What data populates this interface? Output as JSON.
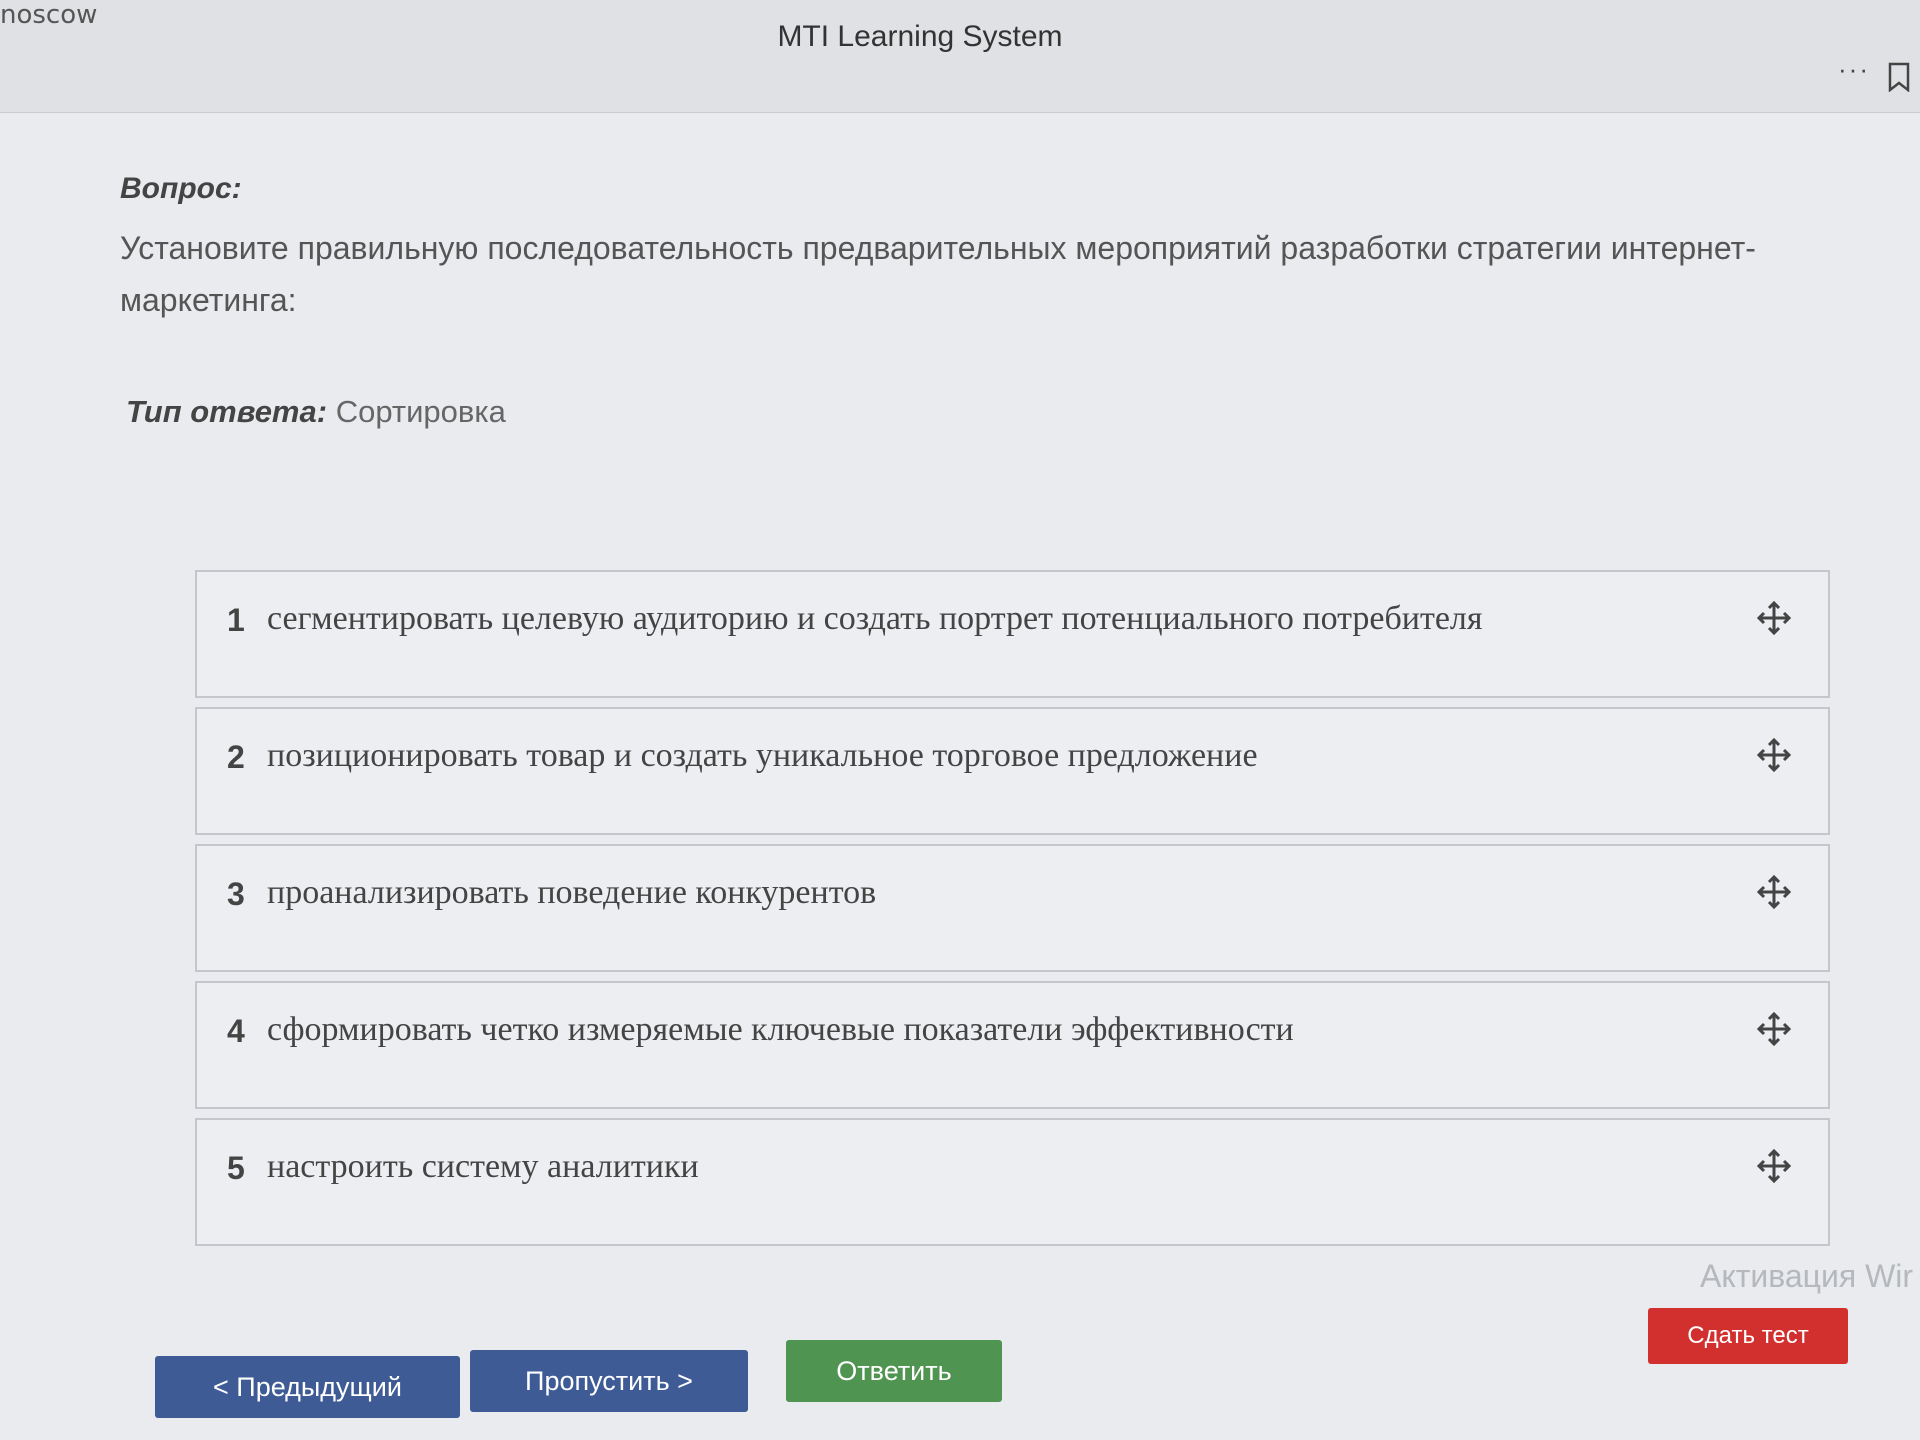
{
  "window": {
    "corner_text": "noscow",
    "title": "MTI Learning System",
    "more_icon": "more-dots-icon",
    "bookmark_icon": "bookmark-icon"
  },
  "question": {
    "label": "Вопрос:",
    "text": "Установите правильную последовательность предварительных мероприятий разработки стратегии интернет-маркетинга:"
  },
  "answer_type": {
    "label": "Тип ответа:",
    "value": "Сортировка"
  },
  "items": [
    {
      "num": "1",
      "text": "сегментировать целевую аудиторию и создать портрет потенциального потребителя"
    },
    {
      "num": "2",
      "text": "позиционировать товар и создать уникальное торговое предложение"
    },
    {
      "num": "3",
      "text": "проанализировать поведение конкурентов"
    },
    {
      "num": "4",
      "text": "сформировать четко измеряемые ключевые показатели эффективности"
    },
    {
      "num": "5",
      "text": "настроить систему аналитики"
    }
  ],
  "buttons": {
    "prev": "< Предыдущий",
    "skip": "Пропустить >",
    "answer": "Ответить",
    "submit": "Сдать тест"
  },
  "watermark": "Активация Wir",
  "colors": {
    "primary_button": "#3e5b95",
    "answer_button": "#4f9451",
    "submit_button": "#d2302f"
  }
}
